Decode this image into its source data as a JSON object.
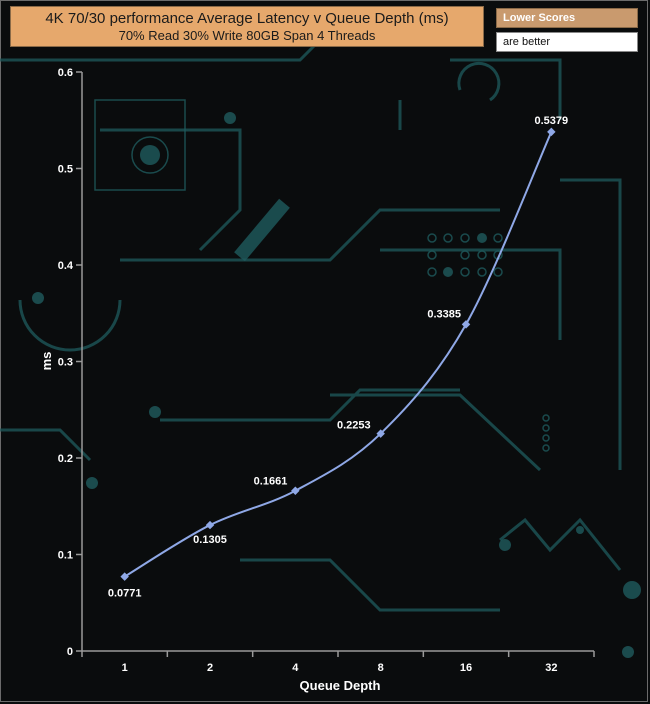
{
  "header": {
    "title": "4K 70/30 performance Average Latency v Queue Depth (ms)",
    "subtitle": "70% Read 30% Write 80GB Span 4 Threads"
  },
  "legend": {
    "heading": "Lower Scores",
    "note": "are better"
  },
  "colors": {
    "title_bg": "#e6a86c",
    "legend_bg": "#c99a6e",
    "line": "#8fa8e6",
    "background": "#0a0c0d",
    "circuit": "#1f5b5e"
  },
  "chart_data": {
    "type": "line",
    "categories": [
      "1",
      "2",
      "4",
      "8",
      "16",
      "32"
    ],
    "values": [
      0.0771,
      0.1305,
      0.1661,
      0.2253,
      0.3385,
      0.5379
    ],
    "value_labels": [
      "0.0771",
      "0.1305",
      "0.1661",
      "0.2253",
      "0.3385",
      "0.5379"
    ],
    "xlabel": "Queue Depth",
    "ylabel": "ms",
    "ylim": [
      0,
      0.6
    ],
    "yticks": [
      "0",
      "0.1",
      "0.2",
      "0.3",
      "0.4",
      "0.5",
      "0.6"
    ],
    "grid": false
  }
}
